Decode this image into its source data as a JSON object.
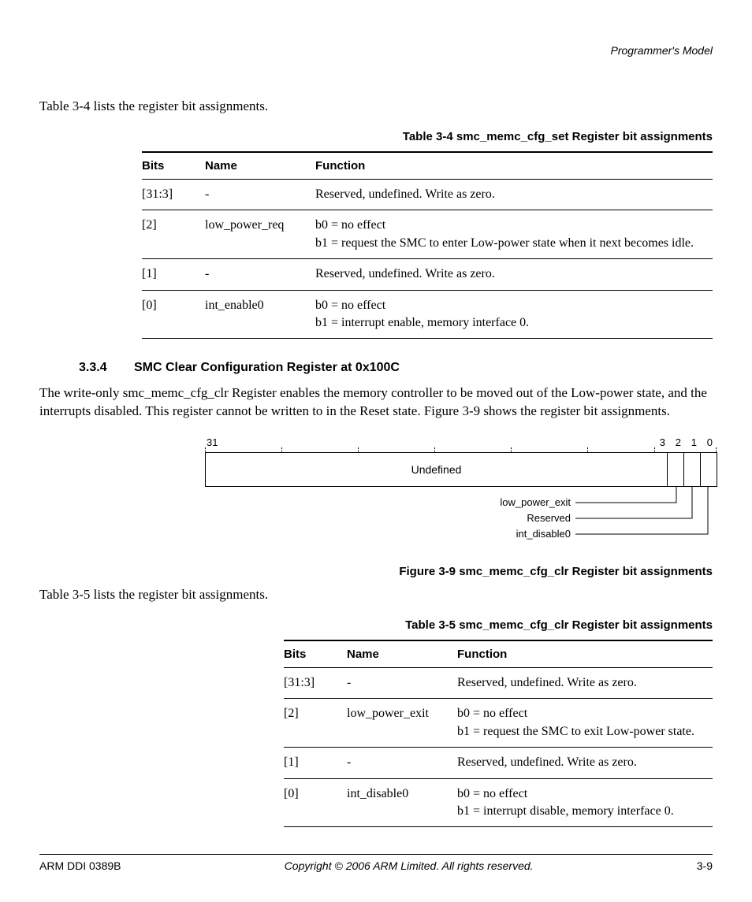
{
  "header": {
    "section": "Programmer's Model"
  },
  "intro1": "Table 3-4 lists the register bit assignments.",
  "table1": {
    "caption": "Table 3-4 smc_memc_cfg_set Register bit assignments",
    "head": {
      "bits": "Bits",
      "name": "Name",
      "func": "Function"
    },
    "rows": [
      {
        "bits": "[31:3]",
        "name": "-",
        "func": "Reserved, undefined. Write as zero."
      },
      {
        "bits": "[2]",
        "name": "low_power_req",
        "func": "b0 = no effect\nb1 = request the SMC to enter Low-power state when it next becomes idle."
      },
      {
        "bits": "[1]",
        "name": "-",
        "func": "Reserved, undefined. Write as zero."
      },
      {
        "bits": "[0]",
        "name": "int_enable0",
        "func": "b0 = no effect\nb1 = interrupt enable, memory interface 0."
      }
    ]
  },
  "section": {
    "num": "3.3.4",
    "title": "SMC Clear Configuration Register at 0x100C",
    "para": "The write-only smc_memc_cfg_clr Register enables the memory controller to be moved out of the Low-power state, and the interrupts disabled. This register cannot be written to in the Reset state. Figure 3-9 shows the register bit assignments."
  },
  "figure": {
    "bit_hi": "31",
    "bit3": "3",
    "bit2": "2",
    "bit1": "1",
    "bit0": "0",
    "undef": "Undefined",
    "l1": "low_power_exit",
    "l2": "Reserved",
    "l3": "int_disable0",
    "caption": "Figure 3-9 smc_memc_cfg_clr Register bit assignments"
  },
  "intro2": "Table 3-5 lists the register bit assignments.",
  "table2": {
    "caption": "Table 3-5 smc_memc_cfg_clr Register bit assignments",
    "head": {
      "bits": "Bits",
      "name": "Name",
      "func": "Function"
    },
    "rows": [
      {
        "bits": "[31:3]",
        "name": "-",
        "func": "Reserved, undefined. Write as zero."
      },
      {
        "bits": "[2]",
        "name": "low_power_exit",
        "func": "b0 = no effect\nb1 = request the SMC to exit Low-power state."
      },
      {
        "bits": "[1]",
        "name": "-",
        "func": "Reserved, undefined. Write as zero."
      },
      {
        "bits": "[0]",
        "name": "int_disable0",
        "func": "b0 = no effect\nb1 = interrupt disable, memory interface 0."
      }
    ]
  },
  "footer": {
    "left": "ARM DDI 0389B",
    "mid": "Copyright © 2006 ARM Limited. All rights reserved.",
    "right": "3-9"
  }
}
